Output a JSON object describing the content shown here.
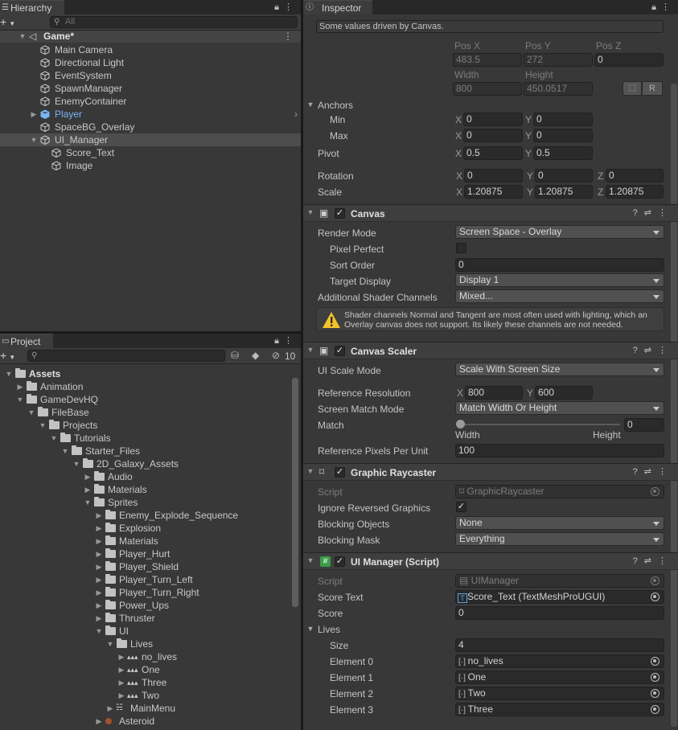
{
  "hierarchy": {
    "tab": "Hierarchy",
    "search_placeholder": "All",
    "scene": "Game*",
    "items": [
      "Main Camera",
      "Directional Light",
      "EventSystem",
      "SpawnManager",
      "EnemyContainer",
      "Player",
      "SpaceBG_Overlay",
      "UI_Manager",
      "Score_Text",
      "Image"
    ]
  },
  "project": {
    "tab": "Project",
    "hidden_count": "10",
    "tree": [
      "Assets",
      "Animation",
      "GameDevHQ",
      "FileBase",
      "Projects",
      "Tutorials",
      "Starter_Files",
      "2D_Galaxy_Assets",
      "Audio",
      "Materials",
      "Sprites",
      "Enemy_Explode_Sequence",
      "Explosion",
      "Materials",
      "Player_Hurt",
      "Player_Shield",
      "Player_Turn_Left",
      "Player_Turn_Right",
      "Power_Ups",
      "Thruster",
      "UI",
      "Lives",
      "no_lives",
      "One",
      "Three",
      "Two",
      "MainMenu",
      "Asteroid"
    ]
  },
  "inspector": {
    "tab": "Inspector",
    "note": "Some values driven by Canvas.",
    "rect": {
      "posx_label": "Pos X",
      "posy_label": "Pos Y",
      "posz_label": "Pos Z",
      "posx": "483.5",
      "posy": "272",
      "posz": "0",
      "width_label": "Width",
      "height_label": "Height",
      "width": "800",
      "height": "450.0517",
      "r_btn": "R",
      "anchors": "Anchors",
      "min": "Min",
      "max": "Max",
      "min_x": "0",
      "min_y": "0",
      "max_x": "0",
      "max_y": "0",
      "pivot": "Pivot",
      "pivot_x": "0.5",
      "pivot_y": "0.5",
      "rotation": "Rotation",
      "rot_x": "0",
      "rot_y": "0",
      "rot_z": "0",
      "scale": "Scale",
      "scale_x": "1.20875",
      "scale_y": "1.20875",
      "scale_z": "1.20875",
      "x": "X",
      "y": "Y",
      "z": "Z"
    },
    "canvas": {
      "title": "Canvas",
      "render_mode_label": "Render Mode",
      "render_mode": "Screen Space - Overlay",
      "pixel_perfect": "Pixel Perfect",
      "sort_order_label": "Sort Order",
      "sort_order": "0",
      "target_display_label": "Target Display",
      "target_display": "Display 1",
      "shader_label": "Additional Shader Channels",
      "shader": "Mixed...",
      "warning": "Shader channels Normal and Tangent are most often used with lighting, which an Overlay canvas does not support. Its likely these channels are not needed."
    },
    "scaler": {
      "title": "Canvas Scaler",
      "mode_label": "UI Scale Mode",
      "mode": "Scale With Screen Size",
      "ref_res_label": "Reference Resolution",
      "ref_x": "800",
      "ref_y": "600",
      "match_mode_label": "Screen Match Mode",
      "match_mode": "Match Width Or Height",
      "match_label": "Match",
      "match_value": "0",
      "width": "Width",
      "height": "Height",
      "ppu_label": "Reference Pixels Per Unit",
      "ppu": "100"
    },
    "raycaster": {
      "title": "Graphic Raycaster",
      "script_label": "Script",
      "script": "GraphicRaycaster",
      "ignore_label": "Ignore Reversed Graphics",
      "blocking_label": "Blocking Objects",
      "blocking": "None",
      "mask_label": "Blocking Mask",
      "mask": "Everything"
    },
    "uimanager": {
      "title": "UI Manager (Script)",
      "script_label": "Script",
      "script": "UIManager",
      "score_text_label": "Score Text",
      "score_text": "Score_Text (TextMeshProUGUI)",
      "score_label": "Score",
      "score": "0",
      "lives_label": "Lives",
      "size_label": "Size",
      "size": "4",
      "elements": [
        {
          "label": "Element 0",
          "value": "no_lives"
        },
        {
          "label": "Element 1",
          "value": "One"
        },
        {
          "label": "Element 2",
          "value": "Two"
        },
        {
          "label": "Element 3",
          "value": "Three"
        }
      ]
    }
  },
  "colors": {
    "panel": "#383838",
    "selection": "#4d4d4d",
    "player_blue": "#7ab4f5",
    "warning": "#f4c32a"
  }
}
